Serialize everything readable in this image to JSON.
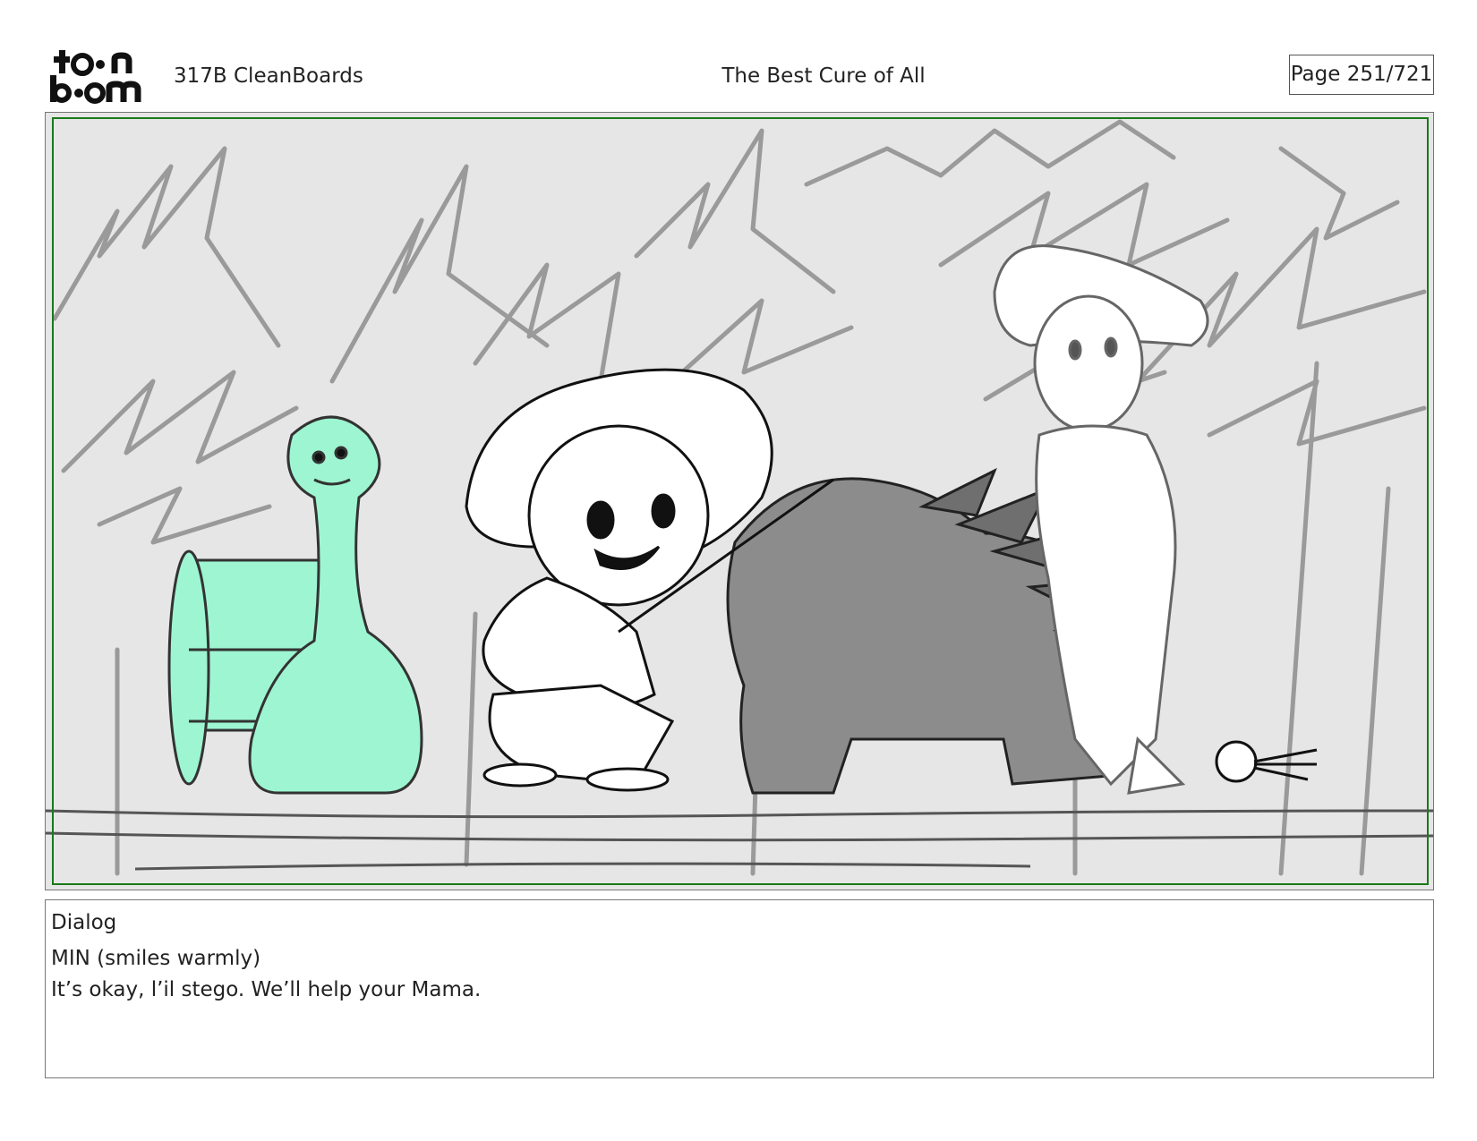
{
  "header": {
    "logo_line1": "toon",
    "logo_line2": "boom",
    "show_label": "317B  CleanBoards",
    "episode_title": "The Best Cure of All",
    "page_label": "Page 251/721"
  },
  "colors": {
    "frame_green": "#1a7a1a",
    "character_mint": "#9ef5d2",
    "creature_gray": "#8c8c8c",
    "background_gray": "#e6e6e6"
  },
  "dialog": {
    "heading": "Dialog",
    "lines": [
      "MIN (smiles warmly)",
      "It’s okay, l’il stego. We’ll help your Mama."
    ]
  }
}
